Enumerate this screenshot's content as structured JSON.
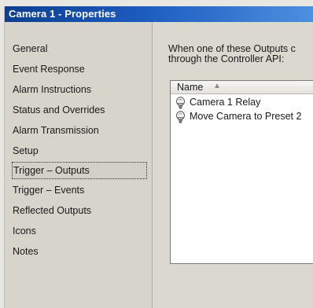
{
  "window": {
    "title": "Camera 1 - Properties"
  },
  "sidebar": {
    "items": [
      {
        "label": "General"
      },
      {
        "label": "Event Response"
      },
      {
        "label": "Alarm Instructions"
      },
      {
        "label": "Status and Overrides"
      },
      {
        "label": "Alarm Transmission"
      },
      {
        "label": "Setup"
      },
      {
        "label": "Trigger – Outputs",
        "selected": true
      },
      {
        "label": "Trigger – Events"
      },
      {
        "label": "Reflected Outputs"
      },
      {
        "label": "Icons"
      },
      {
        "label": "Notes"
      }
    ]
  },
  "main": {
    "description_line1": "When one of these Outputs c",
    "description_line2": "through the Controller API:",
    "list": {
      "column_name": "Name",
      "sort_indicator": "▲",
      "rows": [
        {
          "label": "Camera 1 Relay",
          "icon": "output-bulb-icon"
        },
        {
          "label": "Move Camera to Preset 2",
          "icon": "output-bulb-icon"
        }
      ]
    }
  },
  "colors": {
    "titlebar_start": "#0d3f91",
    "titlebar_end": "#4f8fe0",
    "panel": "#dad8cf"
  }
}
